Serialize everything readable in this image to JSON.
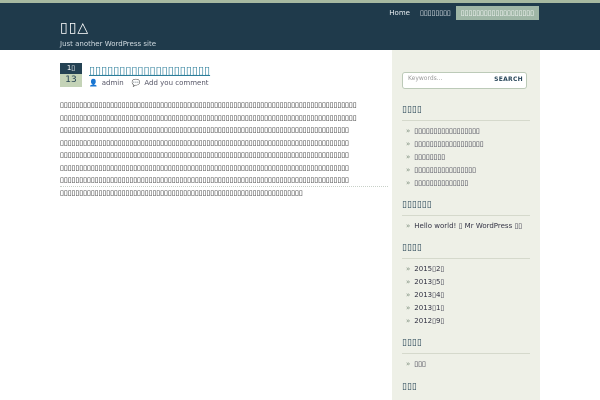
{
  "site": {
    "title": "▯▯△",
    "description": "Just another WordPress site"
  },
  "nav": {
    "items": [
      {
        "label": "Home"
      },
      {
        "label": "▯▯▯▯▯▯▯▯"
      },
      {
        "label": "▯▯▯▯▯▯▯▯▯▯▯▯▯▯▯▯▯▯▯"
      }
    ]
  },
  "search": {
    "placeholder": "Keywords...",
    "button": "SEARCH"
  },
  "post": {
    "month": "1▯",
    "day": "13",
    "title": "▯▯▯▯▯▯▯▯▯▯▯▯▯▯▯▯▯▯▯▯",
    "author": "admin",
    "comment": "Add you comment",
    "body_lines": [
      "▯▯▯▯▯▯▯▯▯▯▯▯▯▯▯▯▯▯▯▯▯▯▯▯▯▯▯▯▯▯▯▯▯▯▯▯▯▯▯▯▯▯▯▯▯▯▯▯▯▯▯▯▯▯▯▯▯▯▯▯▯▯▯▯▯▯▯▯▯▯▯▯▯▯▯▯▯",
      "▯▯▯▯▯▯▯▯▯▯▯▯▯▯▯▯▯▯▯▯▯▯▯▯▯▯▯▯▯▯▯▯▯▯▯▯▯▯▯▯▯▯▯▯▯▯▯▯▯▯▯▯▯▯▯▯▯▯▯▯▯▯▯▯▯▯▯▯▯▯▯▯▯▯▯▯▯",
      "▯▯▯▯▯▯▯▯▯▯▯▯▯▯▯▯▯▯▯▯▯▯▯▯▯▯▯▯▯▯▯▯▯▯▯▯▯▯▯▯▯▯▯▯▯▯▯▯▯▯▯▯▯▯▯▯▯▯▯▯▯▯▯▯▯▯▯▯▯▯▯▯▯▯▯",
      "▯▯▯▯▯▯▯▯▯▯▯▯▯▯▯▯▯▯▯▯▯▯▯▯▯▯▯▯▯▯▯▯▯▯▯▯▯▯▯▯▯▯▯▯▯▯▯▯▯▯▯▯▯▯▯▯▯▯▯▯▯▯▯▯▯▯▯▯▯▯▯▯▯▯▯",
      "▯▯▯▯▯▯▯▯▯▯▯▯▯▯▯▯▯▯▯▯▯▯▯▯▯▯▯▯▯▯▯▯▯▯▯▯▯▯▯▯▯▯▯▯▯▯▯▯▯▯▯▯▯▯▯▯▯▯▯▯▯▯▯▯▯▯▯▯▯▯▯▯▯▯▯",
      "▯▯▯▯▯▯▯▯▯▯▯▯▯▯▯▯▯▯▯▯▯▯▯▯▯▯▯▯▯▯▯▯▯▯▯▯▯▯▯▯▯▯▯▯▯▯▯▯▯▯▯▯▯▯▯▯▯▯▯▯▯▯▯▯▯▯▯▯▯▯▯▯▯▯▯",
      "▯▯▯▯▯▯▯▯▯▯▯▯▯▯▯▯▯▯▯▯▯▯▯▯▯▯▯▯▯▯▯▯▯▯▯▯▯▯▯▯▯▯▯▯▯▯▯▯▯▯▯▯▯▯▯▯▯▯▯▯▯▯▯▯▯▯▯▯▯▯▯▯▯▯▯",
      "▯▯▯▯▯▯▯▯▯▯▯▯▯▯▯▯▯▯▯▯▯▯▯▯▯▯▯▯▯▯▯▯▯▯▯▯▯▯▯▯▯▯▯▯▯▯▯▯▯▯▯▯▯▯▯▯▯▯▯▯▯▯▯"
    ]
  },
  "sidebar": {
    "recent_posts": {
      "title": "▯▯▯▯",
      "items": [
        "▯▯▯▯▯▯▯▯▯▯▯▯▯▯▯▯▯",
        "▯▯▯▯▯▯▯▯▯▯▯▯▯▯▯▯▯▯",
        "▯▯▯▯▯▯▯▯",
        "▯▯▯▯▯▯▯▯▯▯▯▯▯▯▯▯",
        "▯▯▯▯▯▯▯▯▯▯▯▯▯▯"
      ]
    },
    "recent_comments": {
      "title": "▯▯▯▯▯▯",
      "item_prefix": "Hello world!",
      "item_suffix": "▯ Mr WordPress ▯▯"
    },
    "archives": {
      "title": "▯▯▯▯",
      "items": [
        "2015▯2▯",
        "2013▯5▯",
        "2013▯4▯",
        "2013▯1▯",
        "2012▯9▯"
      ]
    },
    "categories": {
      "title": "▯▯▯▯",
      "items": [
        "▯▯▯"
      ]
    },
    "meta": {
      "title": "▯▯▯"
    }
  },
  "colors": {
    "header_bg": "#1f3a4b",
    "accent": "#9fb6a6",
    "sidebar_bg": "#eef0e7"
  }
}
